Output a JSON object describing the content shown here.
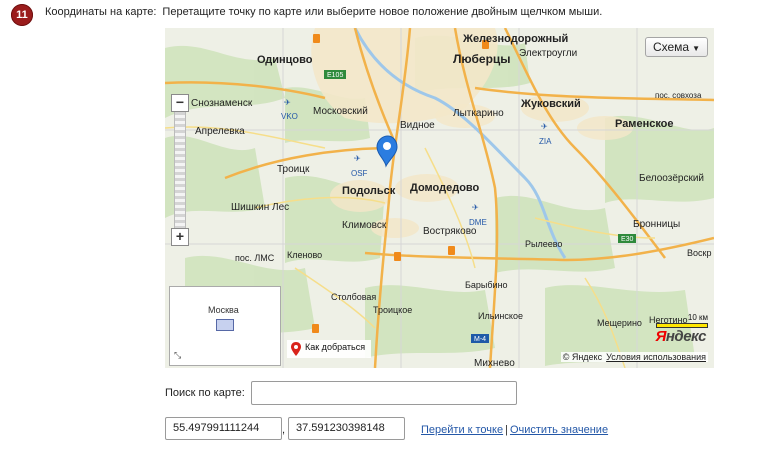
{
  "step": {
    "number": "11"
  },
  "field": {
    "label": "Координаты на карте:",
    "hint": "Перетащите точку по карте или выберите новое положение двойным щелчком мыши."
  },
  "map": {
    "layer_button": "Схема",
    "route_label": "Как добраться",
    "scale_label": "10 км",
    "logo_first": "Я",
    "logo_rest": "ндекс",
    "copyright": "© Яндекс",
    "terms": "Условия использования",
    "minimap_city": "Москва",
    "places": [
      {
        "name": "Железнодорожный",
        "bold": true
      },
      {
        "name": "Электроугли",
        "bold": false
      },
      {
        "name": "Одинцово",
        "bold": true
      },
      {
        "name": "Люберцы",
        "bold": true
      },
      {
        "name": "Жуковский",
        "bold": true
      },
      {
        "name": "Московский",
        "bold": false
      },
      {
        "name": "Видное",
        "bold": false
      },
      {
        "name": "Лыткарино",
        "bold": false
      },
      {
        "name": "Раменское",
        "bold": true
      },
      {
        "name": "Апрелевка",
        "bold": false
      },
      {
        "name": "Троицк",
        "bold": false
      },
      {
        "name": "Подольск",
        "bold": true
      },
      {
        "name": "Домодедово",
        "bold": true
      },
      {
        "name": "Белоозёрский",
        "bold": false
      },
      {
        "name": "Шишкин Лес",
        "bold": false
      },
      {
        "name": "Климовск",
        "bold": false
      },
      {
        "name": "Востряково",
        "bold": false
      },
      {
        "name": "Бронницы",
        "bold": false
      },
      {
        "name": "Рылеево",
        "bold": false
      },
      {
        "name": "пос. ЛМС",
        "bold": false
      },
      {
        "name": "Кленово",
        "bold": false
      },
      {
        "name": "Столбовая",
        "bold": false
      },
      {
        "name": "Барыбино",
        "bold": false
      },
      {
        "name": "Троицкое",
        "bold": false
      },
      {
        "name": "Ильинское",
        "bold": false
      },
      {
        "name": "Мещерино",
        "bold": false
      },
      {
        "name": "Михнево",
        "bold": false
      },
      {
        "name": "пос. совхоза",
        "bold": false
      },
      {
        "name": "Воскр",
        "bold": false
      },
      {
        "name": "Неготино",
        "bold": false
      },
      {
        "name": "Снознаменск",
        "bold": false
      }
    ],
    "airports": [
      "VKO",
      "OSF",
      "ZIA",
      "DME"
    ],
    "roads": [
      "E105",
      "E30",
      "M-4"
    ]
  },
  "search": {
    "label": "Поиск по карте:",
    "value": ""
  },
  "coords": {
    "lat": "55.497991111244",
    "lon": "37.591230398148",
    "separator": ","
  },
  "actions": {
    "goto": "Перейти к точке",
    "separator": "|",
    "clear": "Очистить значение"
  }
}
